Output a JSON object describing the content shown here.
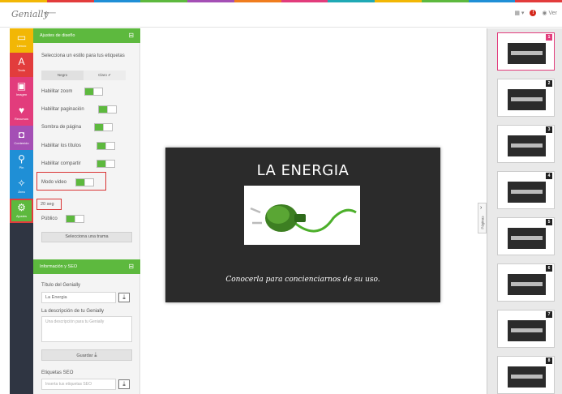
{
  "stripe_colors": [
    "#f2b705",
    "#e23c3c",
    "#1f8fd6",
    "#5db93e",
    "#a44fb5",
    "#f07d1e",
    "#e23c7c",
    "#1fa9b5",
    "#f2b705",
    "#5db93e",
    "#1f8fd6",
    "#e23c3c"
  ],
  "topbar": {
    "logo": "Genially",
    "back_icon": "arrow-left-icon",
    "view_label": "Ver"
  },
  "toolbar": [
    {
      "label": "Lienzo",
      "icon": "canvas-icon",
      "glyph": "▭",
      "color": "#f2b705"
    },
    {
      "label": "Texto",
      "icon": "text-icon",
      "glyph": "A",
      "color": "#e23c3c"
    },
    {
      "label": "Imagen",
      "icon": "image-icon",
      "glyph": "▣",
      "color": "#e23c7c"
    },
    {
      "label": "Recursos",
      "icon": "heart-icon",
      "glyph": "♥",
      "color": "#e23c7c"
    },
    {
      "label": "Contenido",
      "icon": "content-icon",
      "glyph": "◘",
      "color": "#a44fb5"
    },
    {
      "label": "Pin",
      "icon": "pin-icon",
      "glyph": "⚲",
      "color": "#1f8fd6"
    },
    {
      "label": "Área",
      "icon": "wand-icon",
      "glyph": "✧",
      "color": "#1f8fd6"
    },
    {
      "label": "Ajustes",
      "icon": "gear-icon",
      "glyph": "⚙",
      "color": "#5db93e"
    }
  ],
  "design": {
    "header": "Ajustes de diseño",
    "style_prompt": "Selecciona un estilo para tus etiquetas",
    "style_dark": "Negro",
    "style_light": "Claro ✔",
    "zoom": "Habilitar zoom",
    "pagination": "Habilitar paginación",
    "shadow": "Sombra de página",
    "titles": "Habilitar los títulos",
    "share": "Habilitar compartir",
    "video_mode": "Modo video",
    "seconds": "20 seg",
    "public": "Público",
    "pattern_button": "Selecciona una trama"
  },
  "seo": {
    "header": "Información y SEO",
    "title_label": "Título del Genially",
    "title_value": "La Energia",
    "desc_label": "La descripción de tu Genially",
    "desc_placeholder": "Una descripción para tu Genially",
    "save_button": "Guardar",
    "tags_label": "Etiquetas SEO",
    "tags_placeholder": "Inserta tus etiquetas SEO"
  },
  "slide": {
    "title": "LA ENERGIA",
    "subtitle": "Conocerla para concienciarnos de su uso."
  },
  "pages_tab": "Páginas",
  "thumbnails": [
    "1",
    "2",
    "3",
    "4",
    "5",
    "6",
    "7",
    "8"
  ]
}
